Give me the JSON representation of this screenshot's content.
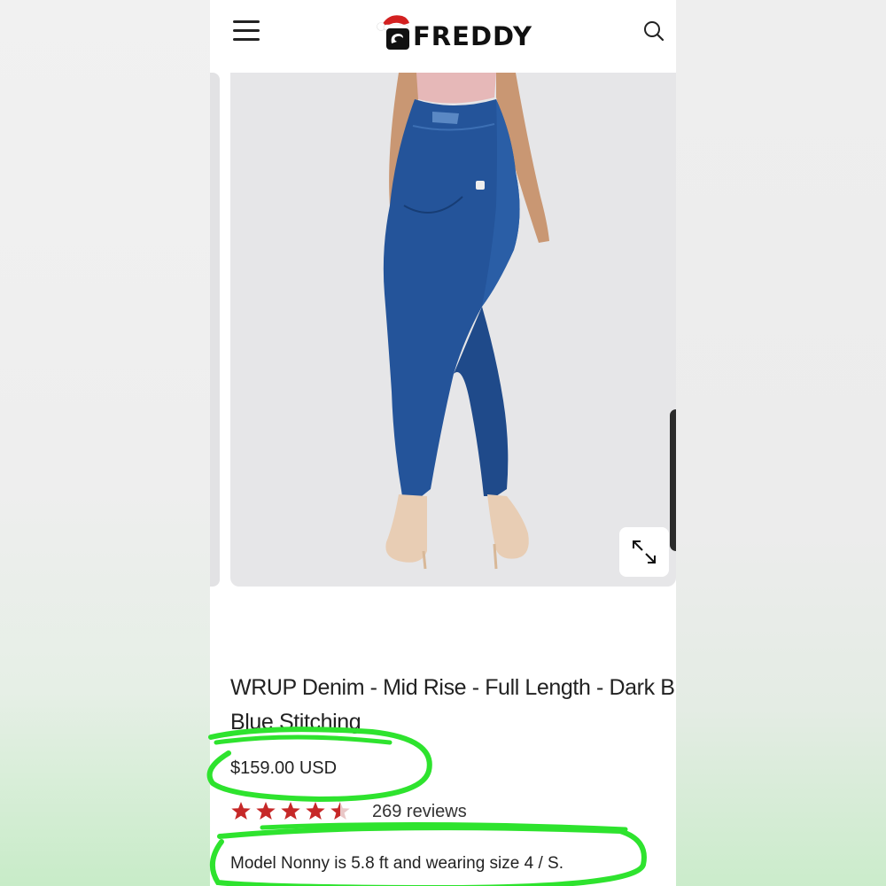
{
  "header": {
    "brand": "FREDDY",
    "menu_icon": "hamburger-menu-icon",
    "search_icon": "search-icon",
    "logo_icon": "freddy-santa-hat-logo"
  },
  "gallery": {
    "expand_icon": "expand-arrows-icon",
    "image_alt": "Model wearing dark blue WRUP jeans with nude heels"
  },
  "product": {
    "title": "WRUP Denim - Mid Rise - Full Length - Dark Blue + Blue Stitching",
    "price": "$159.00 USD",
    "rating": 4.5,
    "rating_max": 5,
    "reviews": "269 reviews",
    "model_note": "Model Nonny is 5.8 ft and wearing size 4 / S."
  },
  "colors": {
    "star": "#c62828",
    "annotation": "#2ee32e",
    "denim": "#24549a"
  }
}
